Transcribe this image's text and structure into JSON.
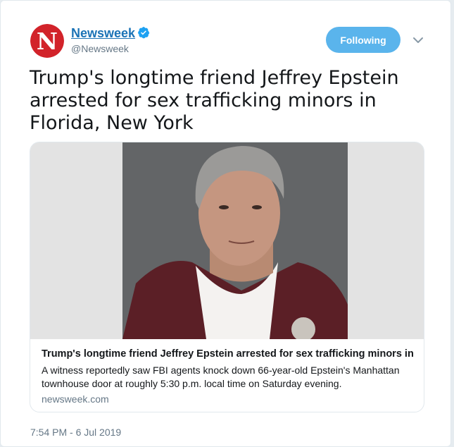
{
  "author": {
    "name": "Newsweek",
    "handle": "@Newsweek",
    "avatar_letter": "N",
    "verified": true
  },
  "follow_button": {
    "label": "Following"
  },
  "tweet": {
    "text": "Trump's longtime friend Jeffrey Epstein arrested for sex trafficking minors in Florida, New York",
    "timestamp": "7:54 PM - 6 Jul 2019"
  },
  "link_card": {
    "title": "Trump's longtime friend Jeffrey Epstein arrested for sex trafficking minors in ...",
    "description": "A witness reportedly saw FBI agents knock down 66-year-old Epstein's Manhattan townhouse door at roughly 5:30 p.m. local time on Saturday evening.",
    "domain": "newsweek.com"
  },
  "colors": {
    "brand_red": "#d2232a",
    "link_blue": "#1b73b6",
    "follow_bg": "#5ab4ec",
    "verified_blue": "#1da1f2",
    "muted_text": "#657786"
  },
  "icons": {
    "verified": "verified-badge-icon",
    "menu": "chevron-down-icon"
  }
}
